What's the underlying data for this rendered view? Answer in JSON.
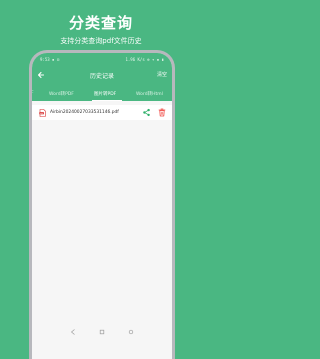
{
  "promo": {
    "title": "分类查询",
    "subtitle": "支持分类查询pdf文件历史"
  },
  "status_bar": {
    "time": "9:53 ▪ ⊡",
    "right": "1.96 K/s ⊕ ▾ ▪ ▮"
  },
  "app_bar": {
    "title": "历史记录",
    "clear_label": "清空"
  },
  "tabs": [
    {
      "label": "F"
    },
    {
      "label": "Word转PDF"
    },
    {
      "label": "图片转PDF",
      "selected": true
    },
    {
      "label": "Word转Html"
    }
  ],
  "file_list": [
    {
      "name": "Airbin20240027033531146.pdf"
    }
  ],
  "colors": {
    "brand_green": "#4ab782",
    "share_green": "#31b16b",
    "delete_red": "#f0413b",
    "pdf_red": "#d62f2f"
  },
  "icons": {
    "back": "arrow-left-icon",
    "pdf": "pdf-file-icon",
    "share": "share-icon",
    "delete": "trash-icon",
    "nav_back": "triangle-back-icon",
    "nav_home": "square-home-icon",
    "nav_recent": "circle-recent-icon"
  }
}
